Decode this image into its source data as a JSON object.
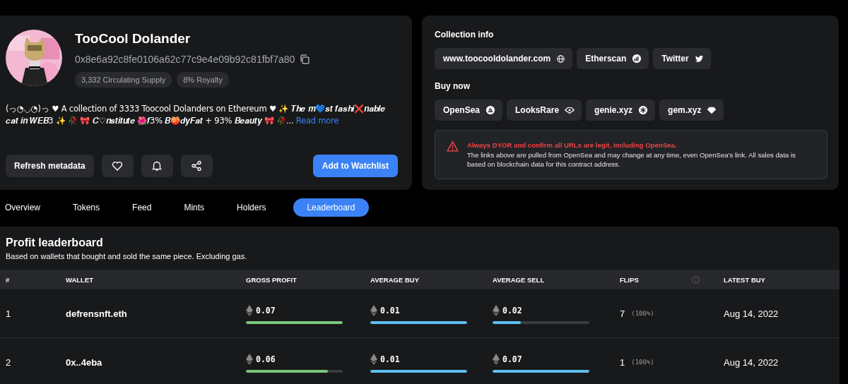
{
  "collection": {
    "name": "TooCool Dolander",
    "address": "0x8e6a92c8fe0106a62c77c9e4e09b92c81fbf7a80",
    "badges": [
      "3,332 Circulating Supply",
      "8% Royalty"
    ],
    "description": "(っ◔◡◔)っ ♥ A collection of 3333 Toocool Dolanders on Ethereum ♥ ✨ 𝑻𝒉𝒆 𝒎💙𝒔𝒕 𝒇𝒂𝒔𝒉𝒊❌𝒏𝒂𝒃𝒍𝒆 𝒄𝒂𝒕 𝒊𝒏 𝑾𝑬𝑩3 ✨ 🥀 🎀 𝑪♡𝒏𝒔𝒕𝒊𝒕𝒖𝒕𝒆 🌺𝒇3% 𝑩🍑𝒅𝒚𝑭𝒂𝒕 + 93% 𝑩𝒆𝒂𝒖𝒕𝒚 🎀 🥀...",
    "read_more": "Read more",
    "actions": [
      {
        "kind": "text",
        "label": "Refresh metadata"
      },
      {
        "kind": "heart"
      },
      {
        "kind": "bell"
      },
      {
        "kind": "share"
      }
    ],
    "watchlist_button": "Add to Watchlist"
  },
  "info": {
    "collection_title": "Collection info",
    "collection_links": [
      {
        "label": "www.toocooldolander.com"
      },
      {
        "label": "Etherscan"
      },
      {
        "label": "Twitter"
      }
    ],
    "buy_title": "Buy now",
    "buy_links": [
      {
        "label": "OpenSea"
      },
      {
        "label": "LooksRare"
      },
      {
        "label": "genie.xyz"
      },
      {
        "label": "gem.xyz"
      }
    ],
    "warning": {
      "title": "Always DYOR and confirm all URLs are legit, including OpenSea.",
      "body": "The links above are pulled from OpenSea and may change at any time, even OpenSea's link. All sales data is based on blockchain data for this contract address."
    }
  },
  "tabs": [
    {
      "label": "Overview",
      "selected": false
    },
    {
      "label": "Tokens",
      "selected": false
    },
    {
      "label": "Feed",
      "selected": false
    },
    {
      "label": "Mints",
      "selected": false
    },
    {
      "label": "Holders",
      "selected": false
    },
    {
      "label": "Leaderboard",
      "selected": true
    }
  ],
  "leaderboard": {
    "title": "Profit leaderboard",
    "subtitle": "Based on wallets that bought and sold the same piece. Excluding gas.",
    "columns": [
      "#",
      "WALLET",
      "GROSS PROFIT",
      "AVERAGE BUY",
      "AVERAGE SELL",
      "FLIPS",
      "LATEST BUY"
    ],
    "rows": [
      {
        "rank": "1",
        "wallet": "defrensnft.eth",
        "gross_profit": {
          "value": "0.07",
          "level": 1
        },
        "average_buy": {
          "value": "0.01",
          "level": 1
        },
        "average_sell": {
          "value": "0.02",
          "level": 0.29
        },
        "flips": "7",
        "flips_share": "(100%)",
        "latest_buy": "Aug 14, 2022"
      },
      {
        "rank": "2",
        "wallet": "0x..4eba",
        "gross_profit": {
          "value": "0.06",
          "level": 0.85
        },
        "average_buy": {
          "value": "0.01",
          "level": 1
        },
        "average_sell": {
          "value": "0.07",
          "level": 1
        },
        "flips": "1",
        "flips_share": "(100%)",
        "latest_buy": "Aug 14, 2022"
      }
    ]
  }
}
